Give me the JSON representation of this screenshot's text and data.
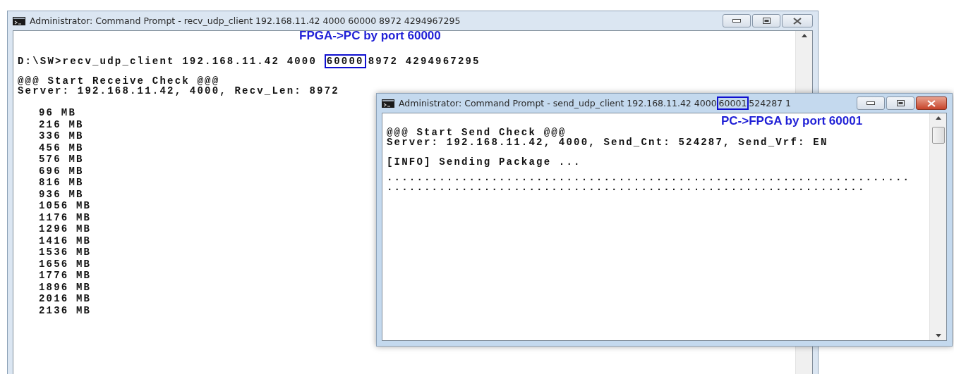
{
  "recv_window": {
    "title": "Administrator: Command Prompt - recv_udp_client  192.168.11.42 4000 60000 8972 4294967295",
    "active": false,
    "annotation": "FPGA->PC by port 60000",
    "command": {
      "prefix": "D:\\SW>recv_udp_client 192.168.11.42 4000 ",
      "highlight": "60000",
      "suffix": "8972 4294967295"
    },
    "lines": [
      "@@@ Start Receive Check @@@",
      "Server: 192.168.11.42, 4000, Recv_Len: 8972"
    ],
    "progress": [
      "96 MB",
      "216 MB",
      "336 MB",
      "456 MB",
      "576 MB",
      "696 MB",
      "816 MB",
      "936 MB",
      "1056 MB",
      "1176 MB",
      "1296 MB",
      "1416 MB",
      "1536 MB",
      "1656 MB",
      "1776 MB",
      "1896 MB",
      "2016 MB",
      "2136 MB"
    ]
  },
  "send_window": {
    "title": {
      "prefix": "Administrator: Command Prompt - send_udp_client  192.168.11.42 4000",
      "highlight": "60001",
      "suffix": "524287 1"
    },
    "active": true,
    "annotation": "PC->FPGA by port 60001",
    "lines": [
      "@@@ Start Send Check @@@",
      "Server: 192.168.11.42, 4000, Send_Cnt: 524287, Send_Vrf: EN"
    ],
    "status": "[INFO] Sending Package ...",
    "dots": [
      "......................................................................",
      "................................................................"
    ]
  }
}
